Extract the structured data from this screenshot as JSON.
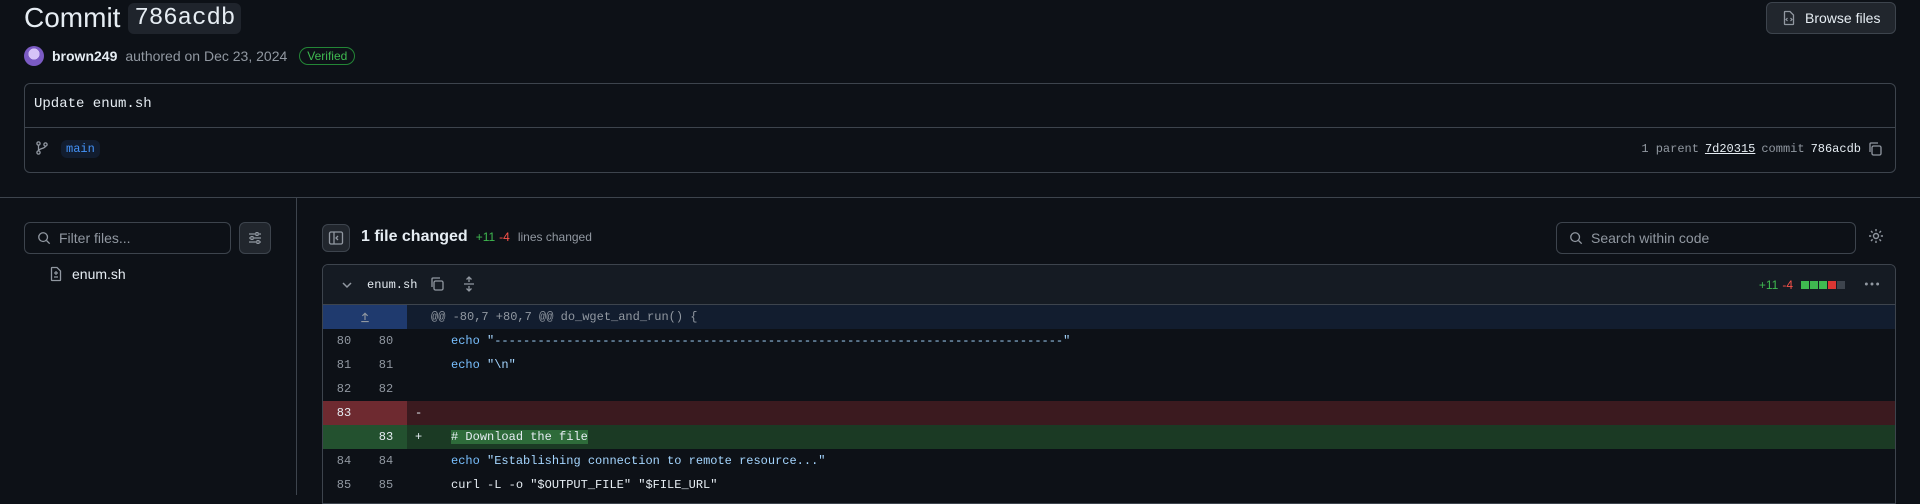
{
  "header": {
    "title_prefix": "Commit",
    "sha": "786acdb",
    "browse_label": "Browse files",
    "author": "brown249",
    "authored_text": "authored on Dec 23, 2024",
    "verified_label": "Verified"
  },
  "message": {
    "text": "Update enum.sh",
    "branch": "main",
    "parent_count": "1 parent",
    "parent_sha": "7d20315",
    "commit_label": "commit",
    "commit_sha": "786acdb"
  },
  "sidebar": {
    "filter_placeholder": "Filter files...",
    "files": [
      "enum.sh"
    ]
  },
  "summary": {
    "files_changed": "1 file changed",
    "additions": "+11",
    "deletions": "-4",
    "lines_changed": "lines changed",
    "search_placeholder": "Search within code"
  },
  "diff": {
    "filename": "enum.sh",
    "additions": "+11",
    "deletions": "-4",
    "hunk_header": "@@ -80,7 +80,7 @@ do_wget_and_run() {",
    "rows": [
      {
        "old": "80",
        "new": "80",
        "type": "ctx",
        "sign": " ",
        "indent": "    ",
        "kw": "echo",
        "rest": " \"-------------------------------------------------------------------------------\""
      },
      {
        "old": "81",
        "new": "81",
        "type": "ctx",
        "sign": " ",
        "indent": "    ",
        "kw": "echo",
        "rest": " \"\\n\""
      },
      {
        "old": "82",
        "new": "82",
        "type": "ctx",
        "sign": " ",
        "indent": "",
        "kw": "",
        "rest": ""
      },
      {
        "old": "83",
        "new": "",
        "type": "del",
        "sign": "-",
        "indent": "",
        "kw": "",
        "rest": ""
      },
      {
        "old": "",
        "new": "83",
        "type": "add",
        "sign": "+",
        "indent": "    ",
        "kw": "",
        "rest": "# Download the file"
      },
      {
        "old": "84",
        "new": "84",
        "type": "ctx",
        "sign": " ",
        "indent": "    ",
        "kw": "echo",
        "rest": " \"Establishing connection to remote resource...\""
      },
      {
        "old": "85",
        "new": "85",
        "type": "ctx",
        "sign": " ",
        "indent": "    ",
        "kw": "",
        "rest": "curl -L -o \"$OUTPUT_FILE\" \"$FILE_URL\""
      }
    ]
  },
  "colors": {
    "background": "#0d1117",
    "accent": "#4493f8",
    "addition": "#3fb950",
    "deletion": "#f85149"
  }
}
